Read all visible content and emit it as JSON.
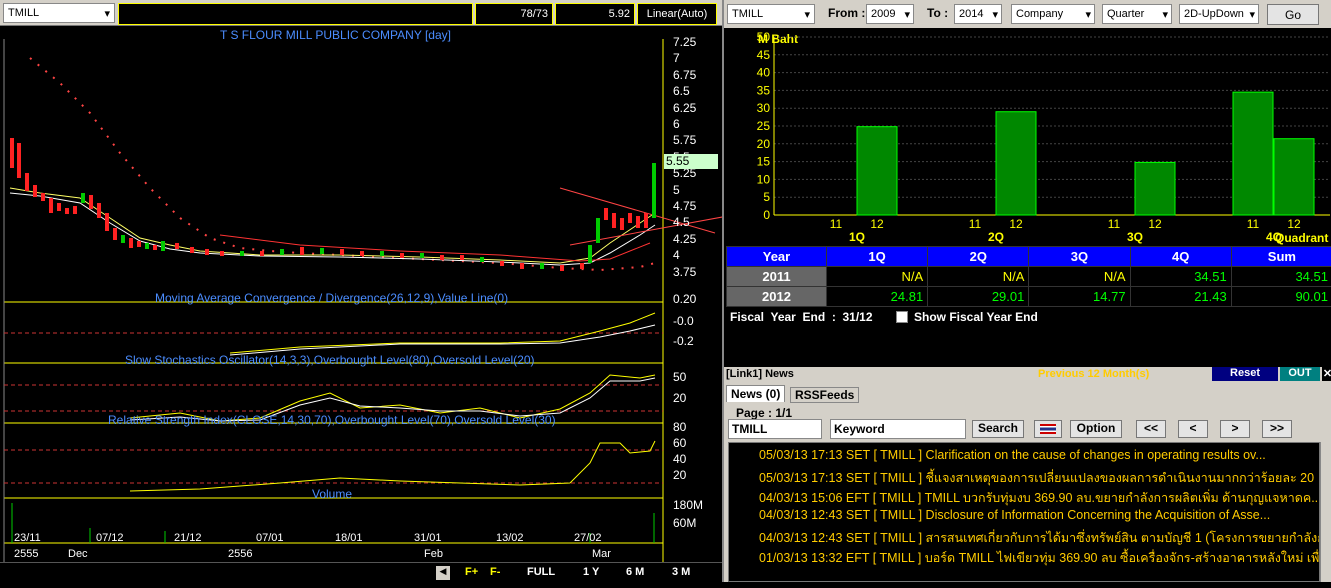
{
  "left": {
    "symbol": "TMILL",
    "ratio": "78/73",
    "price": "5.92",
    "scale": "Linear(Auto)",
    "title": "T S FLOUR MILL PUBLIC COMPANY [day]",
    "last_price_label": "5.55",
    "price_ticks": [
      "7.25",
      "7",
      "6.75",
      "6.5",
      "6.25",
      "6",
      "5.75",
      "5.5",
      "5.25",
      "5",
      "4.75",
      "4.5",
      "4.25",
      "4",
      "3.75"
    ],
    "macd_title": "Moving Average Convergence / Divergence(26,12,9),Value Line(0)",
    "macd_ticks": [
      "0.20",
      "-0.0",
      "-0.2"
    ],
    "sto_title": "Slow Stochastics Oscillator(14,3,3),Overbought Level(80),Oversold Level(20)",
    "sto_ticks": [
      "50",
      "20"
    ],
    "rsi_title": "Relative Strength Index(CLOSE,14,30,70),Overbought Level(70),Oversold Level(30)",
    "rsi_ticks": [
      "80",
      "60",
      "40",
      "20"
    ],
    "vol_title": "Volume",
    "vol_ticks": [
      "180M",
      "60M"
    ],
    "dates": [
      "23/11",
      "07/12",
      "21/12",
      "07/01",
      "18/01",
      "31/01",
      "13/02",
      "27/02"
    ],
    "years": [
      "2555",
      "Dec",
      "2556",
      "Feb",
      "Mar"
    ],
    "bottom_buttons": [
      "F+",
      "F-",
      "FULL",
      "1 Y",
      "6 M",
      "3 M"
    ]
  },
  "right": {
    "symbol": "TMILL",
    "from_label": "From :",
    "from_value": "2009",
    "to_label": "To :",
    "to_value": "2014",
    "entity": "Company",
    "period": "Quarter",
    "view": "2D-UpDown",
    "go": "Go",
    "unit": "M Baht",
    "quadrant_label": "Quadrant",
    "y_ticks": [
      "50",
      "45",
      "40",
      "35",
      "30",
      "25",
      "20",
      "15",
      "10",
      "5",
      "0"
    ],
    "quarter_labels": [
      "1Q",
      "2Q",
      "3Q",
      "4Q"
    ],
    "bar_labels": [
      "11",
      "12"
    ],
    "table_header": [
      "Year",
      "1Q",
      "2Q",
      "3Q",
      "4Q",
      "Sum"
    ],
    "rows": [
      {
        "year": "2011",
        "v": [
          "N/A",
          "N/A",
          "N/A",
          "34.51",
          "34.51"
        ]
      },
      {
        "year": "2012",
        "v": [
          "24.81",
          "29.01",
          "14.77",
          "21.43",
          "90.01"
        ]
      }
    ],
    "fiscal": "Fiscal  Year  End  :  31/12",
    "show_fiscal": "Show Fiscal Year End",
    "news_header": "[Link1] News",
    "prev_months": "Previous 12 Month(s)",
    "reset": "Reset",
    "out": "OUT",
    "tab_news": "News (0)",
    "tab_rss": "RSSFeeds",
    "page": "Page : 1/1",
    "search_symbol": "TMILL",
    "keyword": "Keyword",
    "search": "Search",
    "option": "Option",
    "nav": [
      "<<",
      "<",
      ">",
      ">>"
    ],
    "news": [
      {
        "t": "05/03/13 17:13  SET  [ TMILL ]  Clarification on the cause of changes in operating results ov..."
      },
      {
        "t": "05/03/13 17:13  SET  [ TMILL ]  ชี้แจงสาเหตุของการเปลี่ยนแปลงของผลการดำเนินงานมากกว่าร้อยละ 20"
      },
      {
        "t": "04/03/13 15:06  EFT  [ TMILL ]  TMILL บวกรับทุ่มงบ 369.90 ลบ.ขยายกำลังการผลิตเพิ่ม ด้านกุญแจหาดค..."
      },
      {
        "t": "04/03/13 12:43  SET  [ TMILL ]  Disclosure of Information Concerning the Acquisition of Asse..."
      },
      {
        "t": "04/03/13 12:43  SET  [ TMILL ]  สารสนเทศเกี่ยวกับการได้มาซึ่งทรัพย์สิน ตามบัญชี 1 (โครงการขยายกำลังการ..."
      },
      {
        "t": "01/03/13 13:32  EFT  [ TMILL ]  บอร์ด TMILL ไฟเขียวทุ่ม 369.90 ลบ ซื้อเครื่องจักร-สร้างอาคารหลังใหม่ เพื่อ..."
      }
    ],
    "colors": {
      "bar": "#008800",
      "bar_border": "#00ff00",
      "grid": "#444444",
      "axis": "#ffff00"
    }
  },
  "chart_data": {
    "type": "bar",
    "categories": [
      "1Q-11",
      "1Q-12",
      "2Q-11",
      "2Q-12",
      "3Q-11",
      "3Q-12",
      "4Q-11",
      "4Q-12"
    ],
    "series": [
      {
        "values": [
          0,
          24.81,
          0,
          29.01,
          0,
          14.77,
          34.51,
          21.43
        ]
      }
    ],
    "ylabel": "M Baht",
    "ylim": [
      0,
      50
    ]
  }
}
